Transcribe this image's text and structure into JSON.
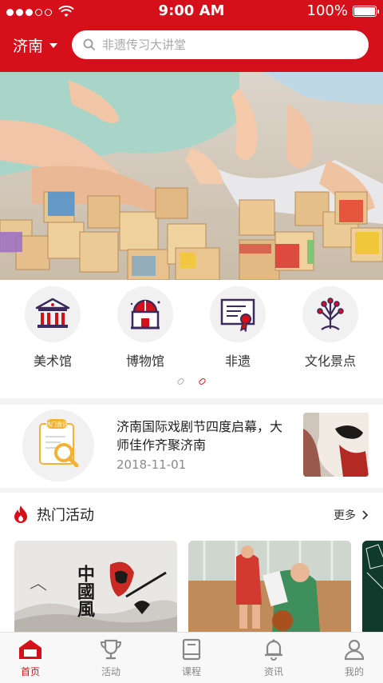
{
  "status": {
    "time": "9:00 AM",
    "battery": "100%"
  },
  "header": {
    "city": "济南",
    "search_placeholder": "非遗传习大讲堂"
  },
  "categories": [
    {
      "label": "美术馆",
      "icon": "art-gallery-icon"
    },
    {
      "label": "博物馆",
      "icon": "museum-icon"
    },
    {
      "label": "非遗",
      "icon": "certificate-icon"
    },
    {
      "label": "文化景点",
      "icon": "scenic-tree-icon"
    }
  ],
  "pager": {
    "pages": 2,
    "active": 2
  },
  "news": {
    "badge": "热门资讯",
    "title": "济南国际戏剧节四度启幕，大师佳作齐聚济南",
    "date": "2018-11-01"
  },
  "hot": {
    "title": "热门活动",
    "more": "更多",
    "card1_text": "中國風"
  },
  "tabs": [
    {
      "label": "首页",
      "icon": "home-icon"
    },
    {
      "label": "活动",
      "icon": "trophy-icon"
    },
    {
      "label": "课程",
      "icon": "book-icon"
    },
    {
      "label": "资讯",
      "icon": "bell-icon"
    },
    {
      "label": "我的",
      "icon": "user-icon"
    }
  ],
  "colors": {
    "brand": "#d6101a",
    "tab_inactive": "#888888"
  }
}
